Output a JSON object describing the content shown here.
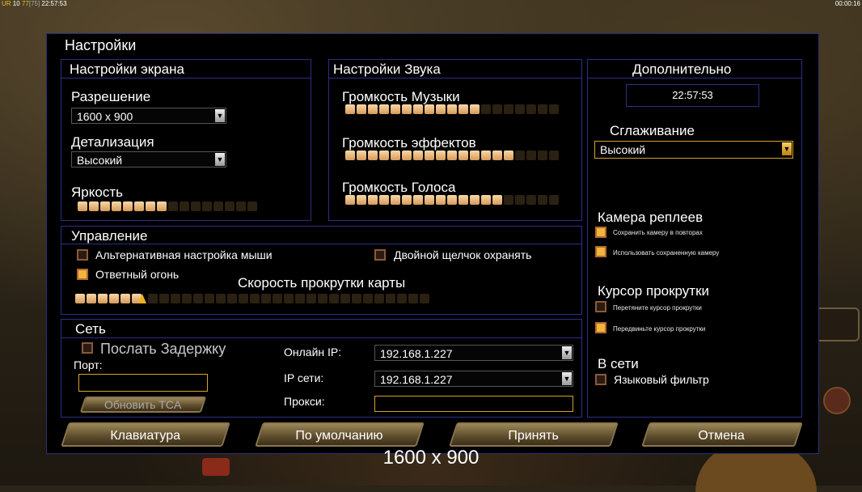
{
  "statusbar": {
    "left_prefix": "UR",
    "left_a": "10",
    "left_b": "77",
    "left_c": "[75]",
    "left_time": "22:57:53",
    "right_time": "00:00:16"
  },
  "dialog": {
    "title": "Настройки"
  },
  "screen": {
    "title": "Настройки экрана",
    "resolution_label": "Разрешение",
    "resolution_value": "1600 x 900",
    "detail_label": "Детализация",
    "detail_value": "Высокий",
    "brightness_label": "Яркость",
    "brightness_level": 8,
    "brightness_segments": 16
  },
  "sound": {
    "title": "Настройки Звука",
    "music_label": "Громкость Музыки",
    "music_level": 12,
    "effects_label": "Громкость эффектов",
    "effects_level": 15,
    "voice_label": "Громкость Голоса",
    "voice_level": 14,
    "segments": 19
  },
  "extra": {
    "title": "Дополнительно",
    "clock": "22:57:53",
    "aa_label": "Сглаживание",
    "aa_value": "Высокий",
    "replay_cam_label": "Камера реплеев",
    "replay_opt1": "Сохранить камеру в повторах",
    "replay_opt2": "Использовать сохраненную камеру",
    "cursor_label": "Курсор прокрутки",
    "cursor_opt1": "Перетяните курсор прокрутки",
    "cursor_opt2": "Передвиньте курсор прокрутки",
    "online_label": "В сети",
    "lang_filter": "Языковый фильтр"
  },
  "controls": {
    "title": "Управление",
    "alt_mouse": "Альтернативная настройка мыши",
    "double_click": "Двойной щелчок охранять",
    "return_fire": "Ответный огонь",
    "scroll_label": "Скорость прокрутки карты",
    "scroll_level": 6,
    "scroll_segments": 31
  },
  "network": {
    "title": "Сеть",
    "send_delay": "Послать Задержку",
    "port_label": "Порт:",
    "port_value": "",
    "update_tca": "Обновить TCA",
    "online_ip_label": "Онлайн IP:",
    "online_ip_value": "192.168.1.227",
    "lan_ip_label": "IP сети:",
    "lan_ip_value": "192.168.1.227",
    "proxy_label": "Прокси:",
    "proxy_value": ""
  },
  "buttons": {
    "keyboard": "Клавиатура",
    "defaults": "По умолчанию",
    "accept": "Принять",
    "cancel": "Отмена"
  },
  "tooltip": "1600 x 900"
}
